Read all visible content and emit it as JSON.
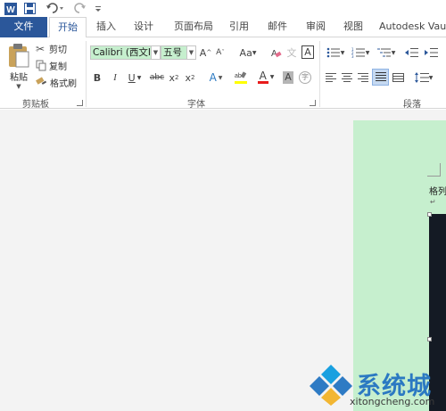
{
  "quick_access": {
    "icons": [
      "word-logo-icon",
      "save-icon",
      "undo-icon",
      "redo-icon",
      "customize-icon"
    ]
  },
  "tabs": [
    "文件",
    "开始",
    "插入",
    "设计",
    "页面布局",
    "引用",
    "邮件",
    "审阅",
    "视图",
    "Autodesk Vau"
  ],
  "clipboard": {
    "paste": "粘贴",
    "cut": "剪切",
    "copy": "复制",
    "format_painter": "格式刷",
    "group": "剪贴板"
  },
  "font": {
    "name": "Calibri (西文I",
    "size": "五号",
    "group": "字体"
  },
  "paragraph": {
    "group": "段落"
  },
  "document": {
    "text": "格列"
  },
  "watermark": {
    "cn": "系统城",
    "url": "xitongcheng.com"
  },
  "colors": {
    "file_tab": "#2b579a",
    "highlight": "#c6efce",
    "page": "#c6efce",
    "font_color_red": "#e81c1c",
    "highlight_yellow": "#ffff00"
  }
}
